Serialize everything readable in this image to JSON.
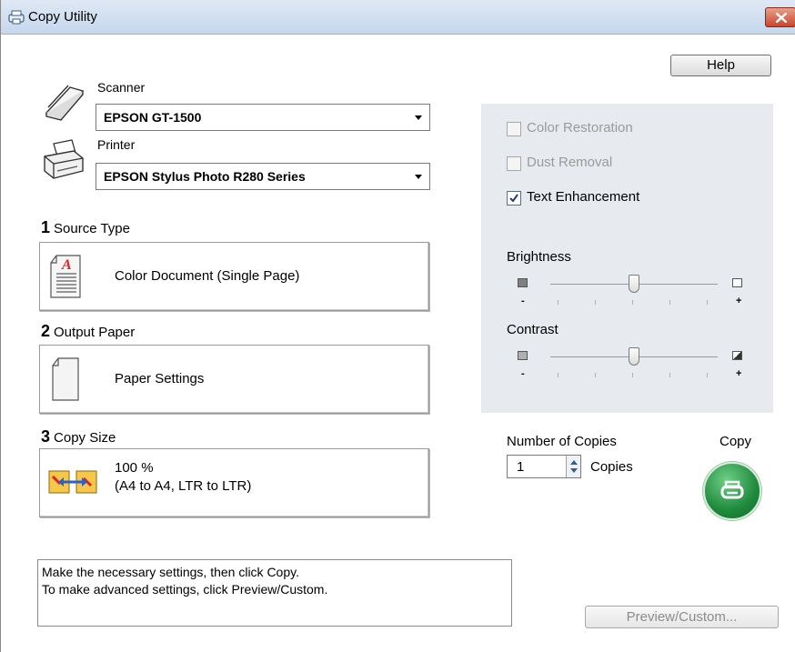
{
  "window": {
    "title": "Copy Utility"
  },
  "toolbar": {
    "help_label": "Help"
  },
  "scanner": {
    "label": "Scanner",
    "selected": "EPSON GT-1500"
  },
  "printer": {
    "label": "Printer",
    "selected": "EPSON Stylus Photo R280 Series"
  },
  "steps": [
    {
      "num": "1",
      "title": "Source Type",
      "value": "Color Document (Single Page)"
    },
    {
      "num": "2",
      "title": "Output Paper",
      "value": "Paper Settings"
    },
    {
      "num": "3",
      "title": "Copy Size",
      "value_line1": "100 %",
      "value_line2": "(A4 to A4, LTR to LTR)"
    }
  ],
  "options": {
    "color_restoration": {
      "label": "Color Restoration",
      "checked": false,
      "enabled": false
    },
    "dust_removal": {
      "label": "Dust Removal",
      "checked": false,
      "enabled": false
    },
    "text_enhancement": {
      "label": "Text Enhancement",
      "checked": true,
      "enabled": true
    }
  },
  "brightness": {
    "label": "Brightness",
    "value": 0.5,
    "minus": "-",
    "plus": "+"
  },
  "contrast": {
    "label": "Contrast",
    "value": 0.5,
    "minus": "-",
    "plus": "+"
  },
  "copies": {
    "label": "Number of Copies",
    "value": "1",
    "unit": "Copies"
  },
  "copy": {
    "label": "Copy"
  },
  "message": {
    "line1": "Make the necessary settings, then click Copy.",
    "line2": "To make advanced settings, click Preview/Custom."
  },
  "preview": {
    "label": "Preview/Custom..."
  },
  "colors": {
    "accent_green": "#1f8a3c",
    "panel_gray": "#e7ebf0",
    "disabled_text": "#9a9a9a"
  }
}
